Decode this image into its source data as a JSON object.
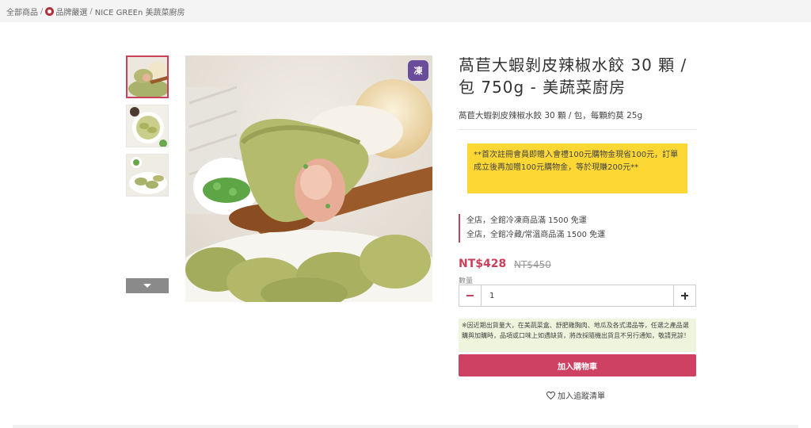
{
  "breadcrumb": {
    "items": [
      "全部商品",
      "品牌嚴選",
      "NICE GREEn 美蔬菜廚房"
    ],
    "separator": "/"
  },
  "product": {
    "title": "萵苣大蝦剝皮辣椒水餃 30 顆 / 包 750g - 美蔬菜廚房",
    "subtitle": "萵苣大蝦剝皮辣椒水餃 30 顆 / 包，每顆約莫 25g",
    "badge_text": "凍",
    "price": "NT$428",
    "original_price": "NT$450"
  },
  "promo": {
    "text": "**首次註冊會員即贈入會禮100元購物金現省100元，訂單成立後再加贈100元購物金，等於現賺200元**"
  },
  "shipping": {
    "lines": [
      "全店，全館冷凍商品滿 1500 免運",
      "全店，全館冷藏/常溫商品滿 1500 免運"
    ]
  },
  "quantity": {
    "label": "數量",
    "value": "1"
  },
  "notice": {
    "text": "※因近期出貨量大，在美蔬菜盒、舒肥雞胸肉、地瓜及各式湯品等，任選之產品選購與加購時，品項或口味上如遇缺貨，將改採隨機出貨且不另行通知，敬請見諒！"
  },
  "actions": {
    "add_to_cart": "加入購物車",
    "wishlist": "加入追蹤清單"
  },
  "colors": {
    "accent": "#cf4163",
    "promo_bg": "#fdd835",
    "notice_bg": "#eef5dc",
    "badge_bg": "#6a4c9c"
  },
  "icons": {
    "brand": "brand-logo-icon",
    "frozen": "frozen-truck-icon",
    "thumb_scroll": "chevron-down-icon",
    "qty_minus": "minus-icon",
    "qty_plus": "plus-icon",
    "wishlist": "heart-icon"
  }
}
